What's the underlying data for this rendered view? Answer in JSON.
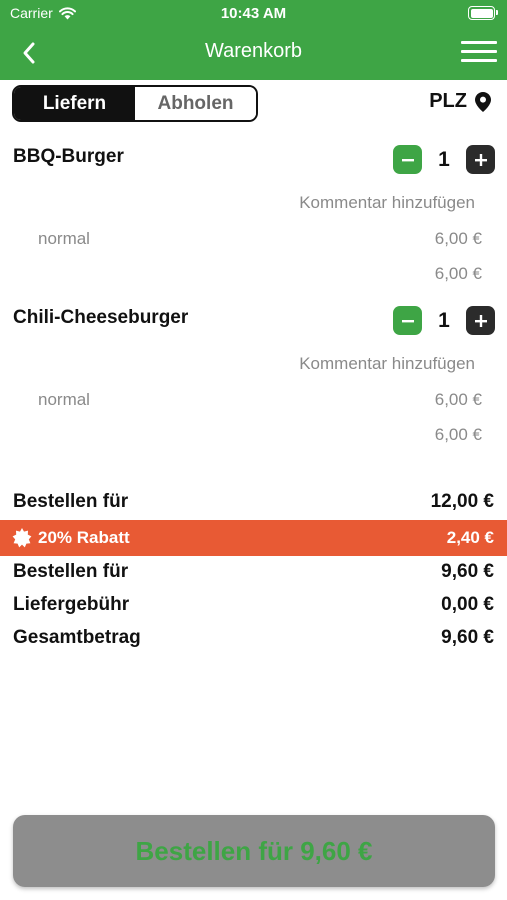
{
  "status": {
    "carrier": "Carrier",
    "time": "10:43 AM"
  },
  "header": {
    "title": "Warenkorb"
  },
  "segment": {
    "options": [
      "Liefern",
      "Abholen"
    ],
    "selected": "Liefern"
  },
  "plz": {
    "label": "PLZ"
  },
  "items": [
    {
      "name": "BBQ-Burger",
      "quantity": "1",
      "comment_label": "Kommentar hinzufügen",
      "variant": "normal",
      "variant_price": "6,00 €",
      "total": "6,00 €"
    },
    {
      "name": "Chili-Cheeseburger",
      "quantity": "1",
      "comment_label": "Kommentar hinzufügen",
      "variant": "normal",
      "variant_price": "6,00 €",
      "total": "6,00 €"
    }
  ],
  "summary": {
    "subtotal_label": "Bestellen für",
    "subtotal": "12,00 €",
    "discount_label": "20% Rabatt",
    "discount": "2,40 €",
    "after_discount_label": "Bestellen für",
    "after_discount": "9,60 €",
    "delivery_label": "Liefergebühr",
    "delivery": "0,00 €",
    "total_label": "Gesamtbetrag",
    "total": "9,60 €"
  },
  "order_button": {
    "label": "Bestellen für 9,60 €"
  },
  "colors": {
    "brand_green": "#3ea545",
    "discount_orange": "#e85a34",
    "disabled_button": "#8d8d8d"
  }
}
